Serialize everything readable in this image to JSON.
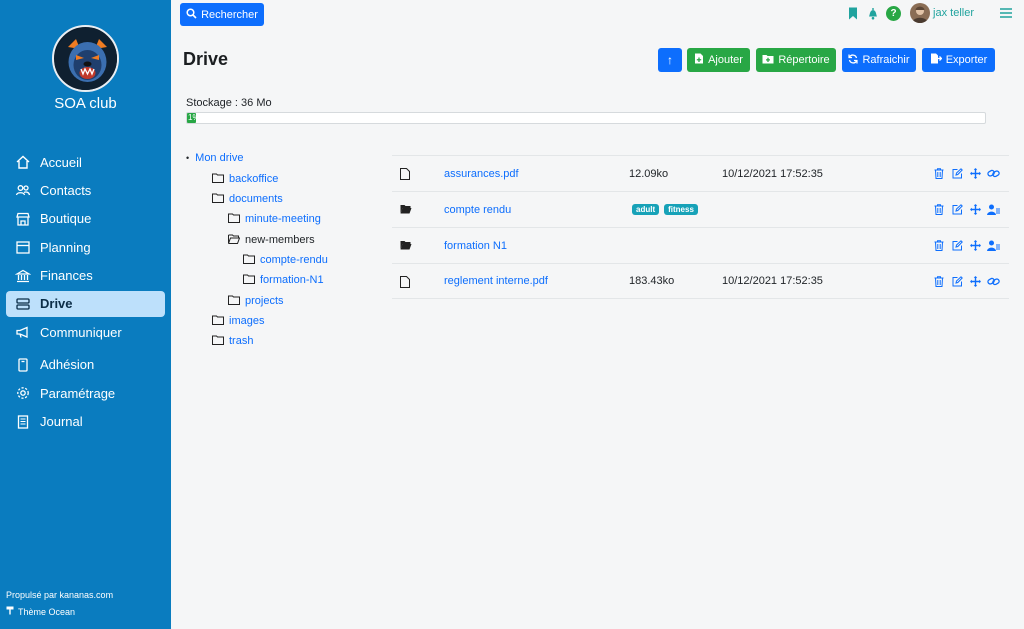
{
  "app": {
    "club_name": "SOA club",
    "footer_powered": "Propulsé par kananas.com",
    "footer_theme": "Thème Ocean"
  },
  "sidebar": {
    "items": [
      {
        "label": "Accueil",
        "icon": "home-icon"
      },
      {
        "label": "Contacts",
        "icon": "users-icon"
      },
      {
        "label": "Boutique",
        "icon": "shop-icon"
      },
      {
        "label": "Planning",
        "icon": "calendar-icon"
      },
      {
        "label": "Finances",
        "icon": "bank-icon"
      },
      {
        "label": "Drive",
        "icon": "drive-icon",
        "active": true
      },
      {
        "label": "Communiquer",
        "icon": "megaphone-icon"
      },
      {
        "label": "Adhésion",
        "icon": "badge-icon"
      },
      {
        "label": "Paramétrage",
        "icon": "gear-icon"
      },
      {
        "label": "Journal",
        "icon": "journal-icon"
      }
    ]
  },
  "topbar": {
    "search_label": "Rechercher",
    "user_name": "jax teller",
    "help_glyph": "?"
  },
  "page": {
    "title": "Drive",
    "up_glyph": "↑",
    "add_label": "Ajouter",
    "folder_label": "Répertoire",
    "refresh_label": "Rafraichir",
    "export_label": "Exporter"
  },
  "storage": {
    "label": "Stockage : 36 Mo",
    "percent_text": "1%",
    "percent": 0.01
  },
  "tree": {
    "root": "Mon drive",
    "nodes": [
      {
        "label": "backoffice",
        "open": false,
        "link": true
      },
      {
        "label": "documents",
        "open": false,
        "link": true
      },
      {
        "label": "minute-meeting",
        "open": false,
        "link": true
      },
      {
        "label": "new-members",
        "open": true,
        "link": false
      },
      {
        "label": "compte-rendu",
        "open": false,
        "link": true
      },
      {
        "label": "formation-N1",
        "open": false,
        "link": true
      },
      {
        "label": "projects",
        "open": false,
        "link": true
      },
      {
        "label": "images",
        "open": false,
        "link": true
      },
      {
        "label": "trash",
        "open": false,
        "link": true
      }
    ]
  },
  "files": [
    {
      "type": "file",
      "name": "assurances.pdf",
      "size": "12.09ko",
      "date": "10/12/2021 17:52:35",
      "tags": [],
      "last_action": "link-icon"
    },
    {
      "type": "folder",
      "name": "compte rendu",
      "size": "",
      "date": "",
      "tags": [
        "adult",
        "fitness"
      ],
      "last_action": "user-share-icon"
    },
    {
      "type": "folder",
      "name": "formation N1",
      "size": "",
      "date": "",
      "tags": [],
      "last_action": "user-share-icon"
    },
    {
      "type": "file",
      "name": "reglement interne.pdf",
      "size": "183.43ko",
      "date": "10/12/2021 17:52:35",
      "tags": [],
      "last_action": "link-icon"
    }
  ],
  "colors": {
    "sidebar": "#0a7cbf",
    "primary": "#0d6efd",
    "success": "#28a745",
    "tag": "#17a2b8",
    "teal_icons": "#20a39e"
  }
}
